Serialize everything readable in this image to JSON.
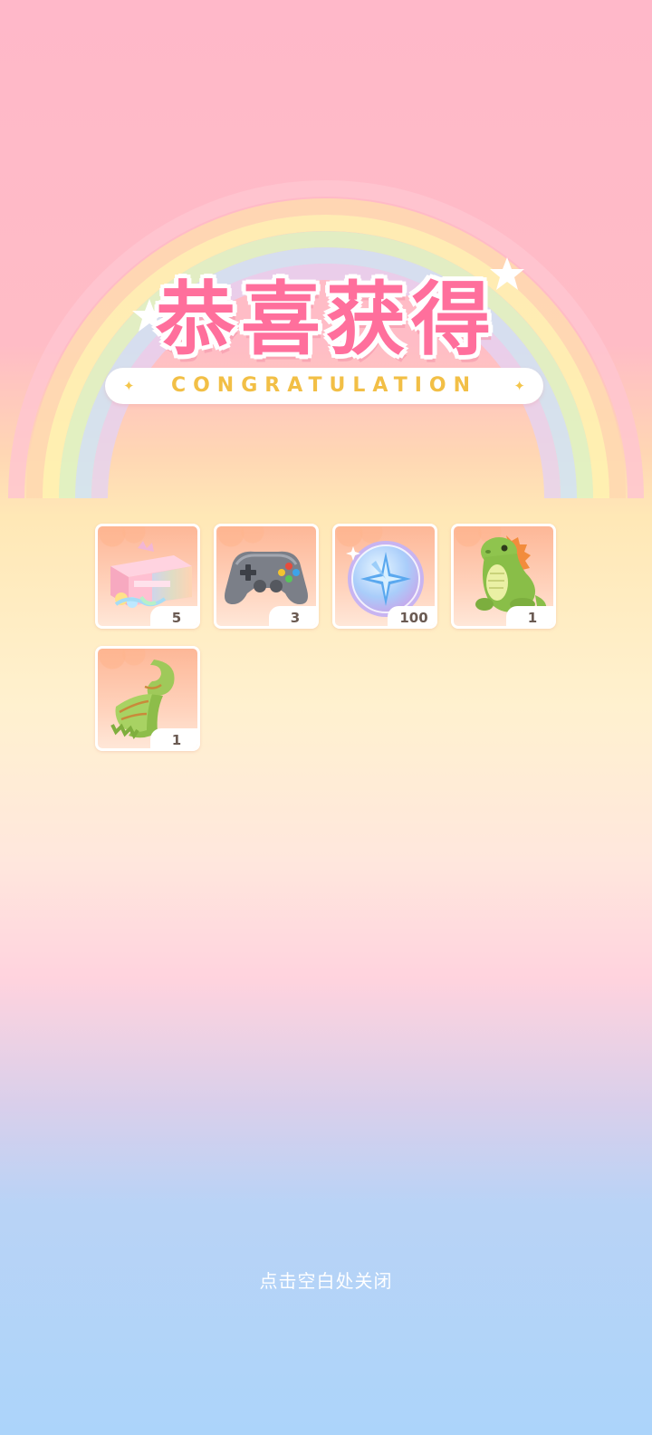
{
  "title": {
    "main": "恭喜获得",
    "sub": "CONGRATULATION",
    "sparkle": "✦"
  },
  "rewards": [
    {
      "name": "gift-box",
      "qty": "5"
    },
    {
      "name": "game-controller",
      "qty": "3"
    },
    {
      "name": "star-coin",
      "qty": "100"
    },
    {
      "name": "dinosaur-plush",
      "qty": "1"
    },
    {
      "name": "green-scarf",
      "qty": "1"
    }
  ],
  "footer": {
    "close_hint": "点击空白处关闭"
  },
  "colors": {
    "title_pink": "#ff6f9c",
    "banner_gold": "#f2bf46",
    "card_orange": "#fdb797",
    "qty_text": "#6a5a52"
  }
}
